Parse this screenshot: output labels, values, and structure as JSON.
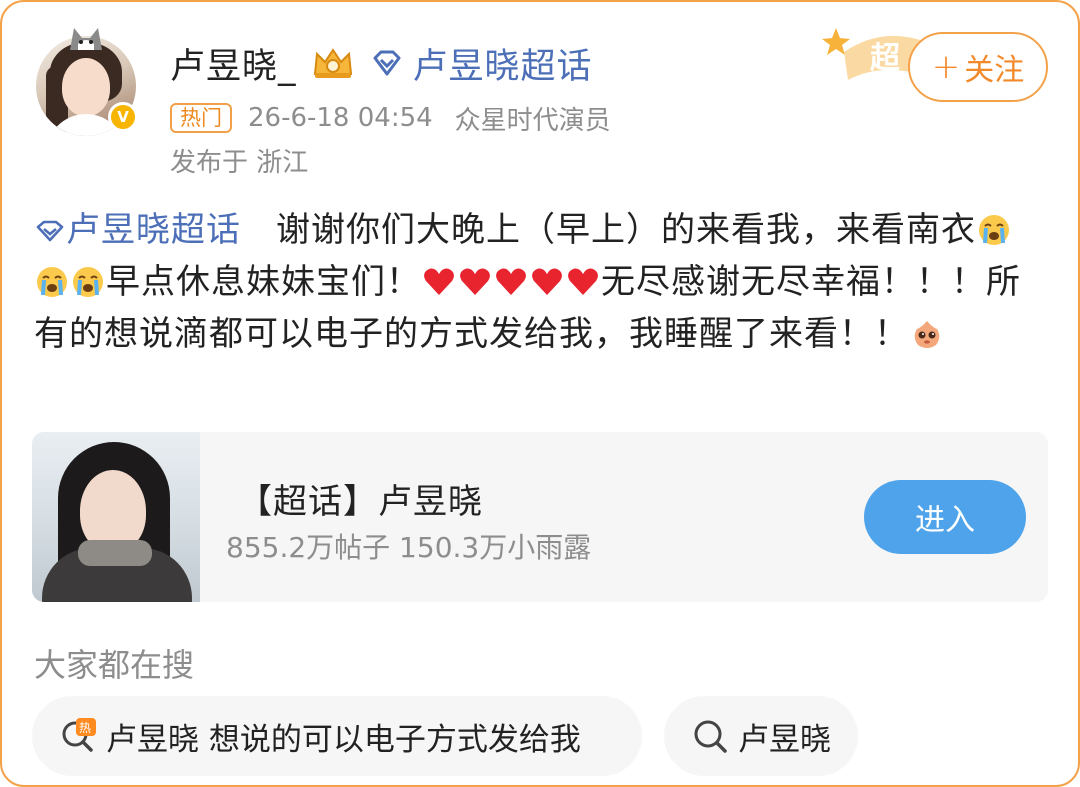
{
  "user": {
    "name": "卢昱晓_",
    "supertopic_link": "卢昱晓超话",
    "hot_badge": "热门",
    "timestamp": "26-6-18 04:54",
    "agency": "众星时代演员",
    "location": "发布于 浙江",
    "chao_badge": "超",
    "follow_label": "关注"
  },
  "post": {
    "tag": "卢昱晓超话",
    "text_1": "　谢谢你们大晚上（早上）的来看我，来看南衣",
    "text_2": "早点休息妹妹宝们！",
    "text_3": "无尽感谢无尽幸福！！！所有的想说滴都可以电子的方式发给我，我睡醒了来看！！",
    "icons": [
      "crying-emoji",
      "red-heart-emoji",
      "shy-face-emoji"
    ]
  },
  "topic_card": {
    "title": "【超话】卢昱晓",
    "stats": "855.2万帖子 150.3万小雨露",
    "enter_label": "进入"
  },
  "search": {
    "heading": "大家都在搜",
    "chips": [
      {
        "label": "卢昱晓 想说的可以电子方式发给我",
        "icon": "hot-search-icon"
      },
      {
        "label": "卢昱晓",
        "icon": "search-icon"
      }
    ]
  },
  "colors": {
    "accent_orange": "#f3a24a",
    "link_blue": "#4c6fb8",
    "button_blue": "#4fa3ea",
    "muted_gray": "#8d8d8d"
  }
}
